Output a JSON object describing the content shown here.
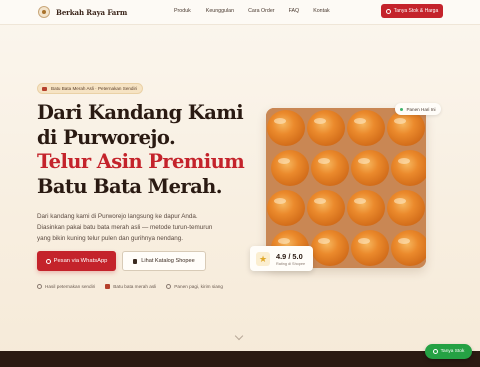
{
  "brand": {
    "name": "Berkah Raya Farm"
  },
  "nav": {
    "items": [
      "Produk",
      "Keunggulan",
      "Cara Order",
      "FAQ",
      "Kontak"
    ],
    "cta": "Tanya Stok & Harga"
  },
  "hero": {
    "pill": "Batu Bata Merah Asli · Peternakan Sendiri",
    "title_line1": "Dari Kandang Kami",
    "title_line2": "di Purworejo.",
    "title_line3": "Telur Asin Premium",
    "title_line4": "Batu Bata Merah.",
    "description": "Dari kandang kami di Purworejo langsung ke dapur Anda. Diasinkan pakai batu bata merah asli — metode turun-temurun yang bikin kuning telur pulen dan gurihnya nendang.",
    "primary_button": "Pesan via WhatsApp",
    "secondary_button": "Lihat Katalog Shopee",
    "features": [
      "Hasil peternakan sendiri",
      "Batu bata merah asli",
      "Panen pagi, kirim siang"
    ]
  },
  "media": {
    "badge": "Panen Hari Ini",
    "rating_value": "4.9 / 5.0",
    "rating_label": "Rating di Shopee"
  },
  "floating": {
    "label": "Tanya Stok"
  },
  "icons": {
    "whatsapp": "whatsapp-icon",
    "shopee": "shopping-bag-icon",
    "star": "star-icon",
    "scroll": "chevron-down-icon"
  },
  "colors": {
    "accent": "#c4232b",
    "whatsapp": "#25a144",
    "dark": "#2b1a12",
    "background": "#fbf6ee"
  }
}
